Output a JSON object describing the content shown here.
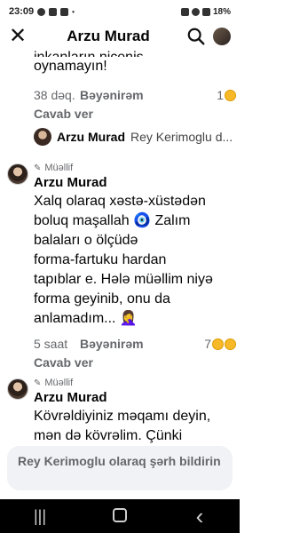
{
  "status_bar": {
    "time": "23:09",
    "battery": "18%"
  },
  "header": {
    "title": "Arzu Murad"
  },
  "comments": {
    "top": {
      "text_partial": "inkanların niceniş",
      "text_line": "oynamayın!",
      "time": "38 dəq.",
      "like_label": "Bəyənirəm",
      "reply_label": "Cavab ver",
      "reaction_count": "1"
    },
    "thread_preview": {
      "name": "Arzu Murad",
      "rest": "Rey Kerimoglu d..."
    },
    "first": {
      "badge": "Müəllif",
      "name": "Arzu Murad",
      "lines": [
        "Xalq olaraq xəstə-xüstədən",
        "boluq maşallah 🧿 Zalım",
        "balaları o ölçüdə",
        "forma-fartuku hardan",
        "tapıblar e. Hələ müəllim niyə",
        "forma geyinib, onu da",
        "anlamadım... 🤦‍♀️"
      ],
      "time": "5 saat",
      "like_label": "Bəyənirəm",
      "reply_label": "Cavab ver",
      "reaction_count": "7"
    },
    "second": {
      "badge": "Müəllif",
      "name": "Arzu Murad",
      "lines": [
        "Kövrəldiyiniz məqamı deyin,",
        "mən də kövrəlim. Çünki"
      ]
    }
  },
  "input": {
    "placeholder": "Rey Kerimoglu olaraq şərh bildirin"
  },
  "nav": {
    "recents": "|||",
    "home": "○",
    "back": "‹"
  }
}
